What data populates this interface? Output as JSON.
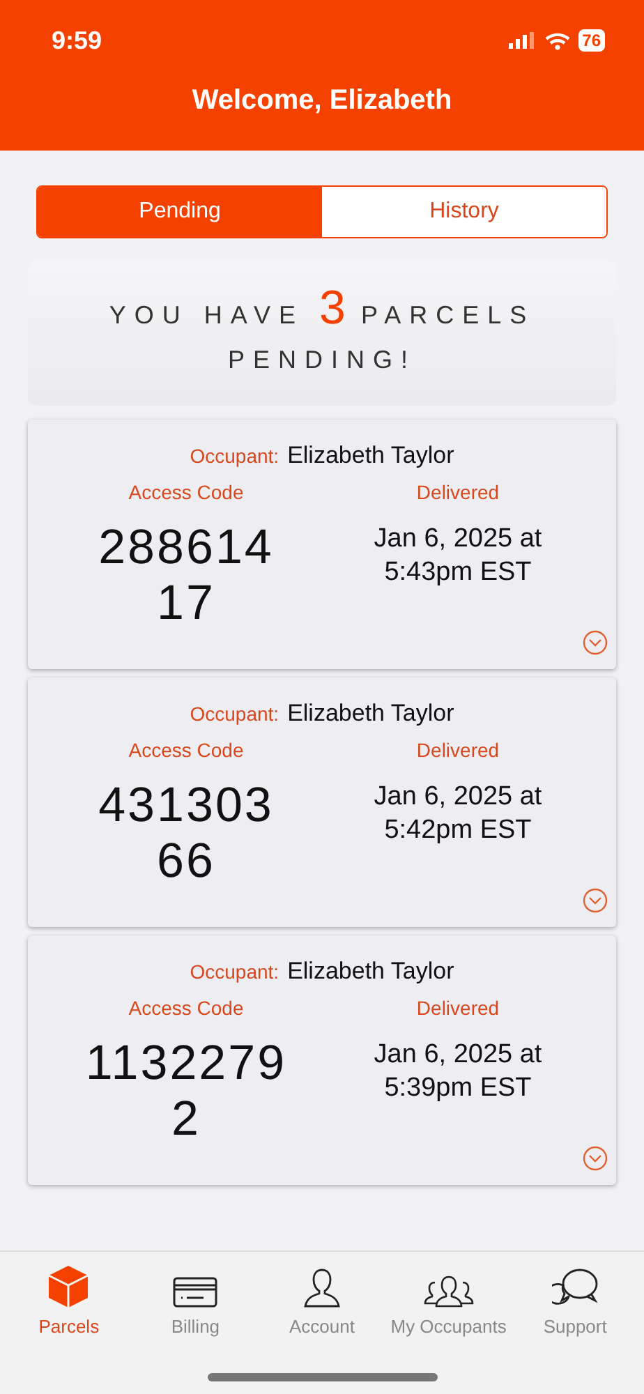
{
  "status_bar": {
    "time": "9:59",
    "battery": "76"
  },
  "header": {
    "title": "Welcome, Elizabeth"
  },
  "tabs": [
    {
      "label": "Pending",
      "selected": true
    },
    {
      "label": "History",
      "selected": false
    }
  ],
  "banner": {
    "before": "YOU HAVE",
    "count": "3",
    "after": "PARCELS PENDING!"
  },
  "parcels": [
    {
      "occupant_label": "Occupant:",
      "occupant": "Elizabeth Taylor",
      "code_label": "Access Code",
      "code": "288614\n17",
      "delivered_label": "Delivered",
      "delivered": "Jan 6, 2025 at 5:43pm EST"
    },
    {
      "occupant_label": "Occupant:",
      "occupant": "Elizabeth Taylor",
      "code_label": "Access Code",
      "code": "431303\n66",
      "delivered_label": "Delivered",
      "delivered": "Jan 6, 2025 at 5:42pm EST"
    },
    {
      "occupant_label": "Occupant:",
      "occupant": "Elizabeth Taylor",
      "code_label": "Access Code",
      "code": "1132279\n2",
      "delivered_label": "Delivered",
      "delivered": "Jan 6, 2025 at 5:39pm EST"
    }
  ],
  "nav": [
    {
      "label": "Parcels",
      "selected": true
    },
    {
      "label": "Billing",
      "selected": false
    },
    {
      "label": "Account",
      "selected": false
    },
    {
      "label": "My Occupants",
      "selected": false
    },
    {
      "label": "Support",
      "selected": false
    }
  ]
}
